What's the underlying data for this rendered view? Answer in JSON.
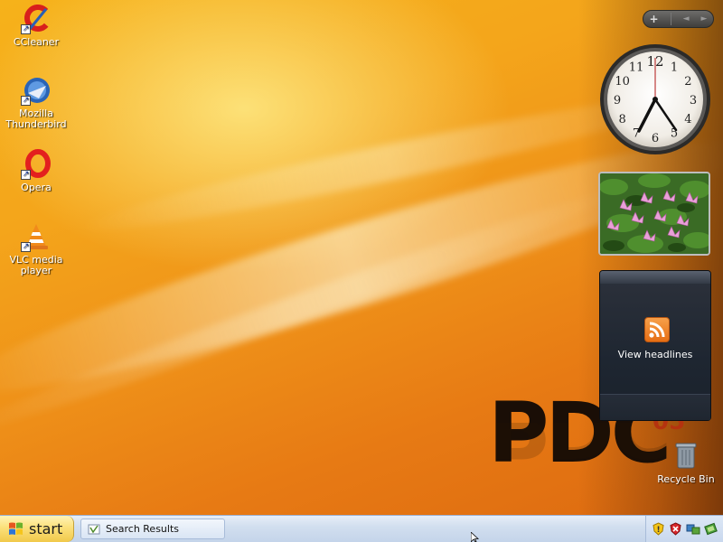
{
  "desktop": {
    "icons": [
      {
        "label": "CCleaner"
      },
      {
        "label": "Mozilla Thunderbird"
      },
      {
        "label": "Opera"
      },
      {
        "label": "VLC media player"
      }
    ],
    "recycle_bin_label": "Recycle Bin",
    "wallpaper": {
      "logo_text": "PDC",
      "logo_sup": "05"
    }
  },
  "sidebar": {
    "toolbar": {
      "add_label": "+",
      "prev_label": "◄",
      "next_label": "►"
    },
    "clock": {
      "numerals": [
        "12",
        "1",
        "2",
        "3",
        "4",
        "5",
        "6",
        "7",
        "8",
        "9",
        "10",
        "11"
      ]
    },
    "feed": {
      "label": "View headlines",
      "icon": "rss-icon"
    }
  },
  "taskbar": {
    "start_label": "start",
    "tasks": [
      {
        "label": "Search Results",
        "icon": "search-window-icon"
      }
    ],
    "tray_icons": [
      "security-alert-icon",
      "security-shield-icon",
      "network-icon",
      "update-icon"
    ]
  },
  "colors": {
    "wallpaper_orange": "#f4a51b",
    "start_yellow": "#fbe07a",
    "taskbar_blue": "#d2dfef",
    "feed_bg": "#1e2631",
    "rss_orange": "#f18a2c"
  }
}
